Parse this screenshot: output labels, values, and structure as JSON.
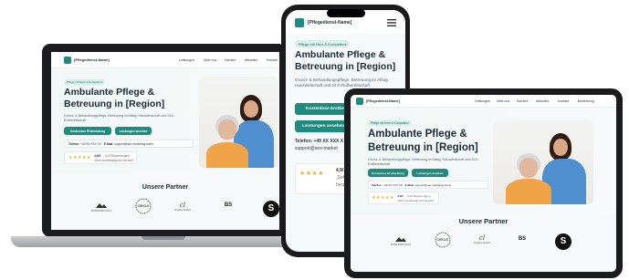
{
  "site": {
    "brand": "[Pflegedienst-Name]",
    "nav": [
      "Leistungen",
      "Über uns",
      "Karriere",
      "Aktuelles",
      "Kontakt",
      "Bewerbung"
    ],
    "badge": "Pflege mit Herz & Kompetenz",
    "headline": "Ambulante Pflege & Betreuung in [Region]",
    "subline": "Grund- & Behandlungspflege, Betreuung im Alltag, Hauswirtschaft und 24-h-Rufbereitschaft.",
    "cta_primary": "Kostenlose Erstberatung",
    "cta_secondary": "Leistungen ansehen",
    "phone_label": "Telefon:",
    "phone_value": "+49 XX XXX XX",
    "email_label": "E-Mail:",
    "email_value": "support@seo-marketing.koeln",
    "rating_stars": "★★★★★",
    "rating_value": "4,9/5",
    "rating_count": "(120 Bewertungen)",
    "rating_quote": "„Sehr zuverlässig und herzlich\"",
    "partners_title": "Unsere Partner",
    "partners": [
      "WWW PORTFOLIO",
      "CIRCLE",
      "Creative Studios",
      "BS",
      "S"
    ]
  },
  "phone_view": {
    "brand": "[Pflegedienst-Name]",
    "badge": "Pflege mit Herz & Kompetenz",
    "headline": "Ambulante Pflege & Betreuung in [Region]",
    "subline": "Grund- & Behandlungspflege, Betreuung im Alltag, Hauswirtschaft und 24-h-Rufbereitschaft.",
    "cta_primary": "Kostenlose Erstbera",
    "cta_secondary": "Leistungen ansehen",
    "phone_line": "Telefon: +49 XX XXX X",
    "email_line": "support@seo-market",
    "rating_stars": "★★★★",
    "rating_value": "4,9/",
    "rating_quote": "„Sehr",
    "rating_quote2": "herzlic"
  },
  "colors": {
    "accent": "#1e8a80",
    "badge_bg": "#d8efe9",
    "star": "#f0b323",
    "device_frame": "#1b1b1d"
  }
}
